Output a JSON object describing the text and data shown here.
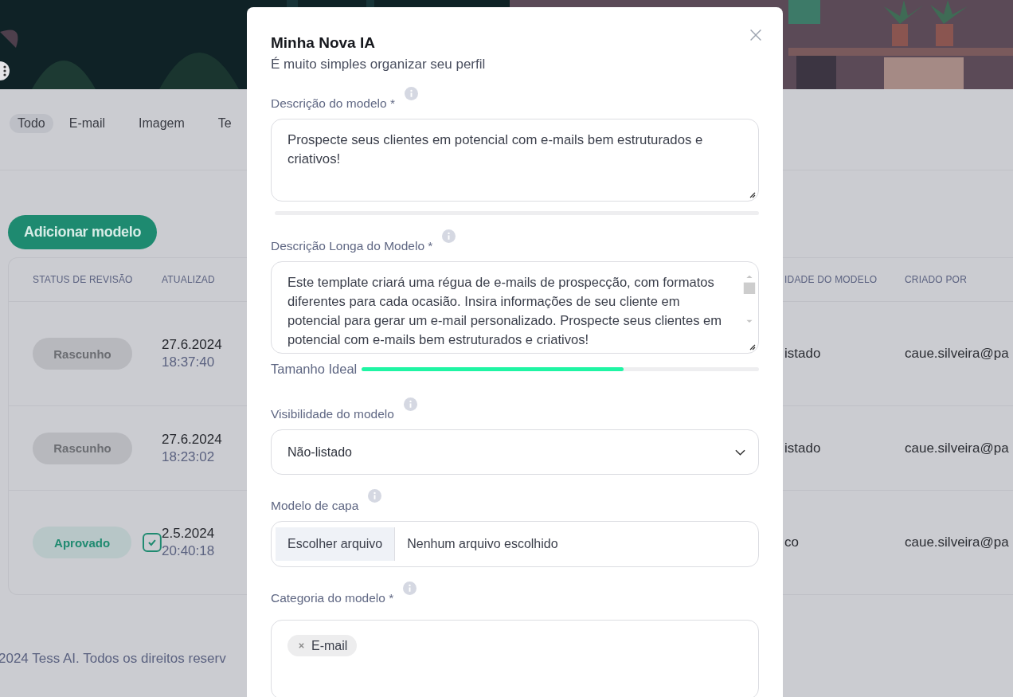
{
  "filter_tabs": [
    {
      "label": "Todo",
      "selected": true
    },
    {
      "label": "E-mail",
      "selected": false
    },
    {
      "label": "Imagem",
      "selected": false
    },
    {
      "label": "Te",
      "selected": false
    }
  ],
  "add_button": "Adicionar modelo",
  "table": {
    "columns": [
      "STATUS DE REVISÃO",
      "ATUALIZAD",
      "IDADE DO MODELO",
      "CRIADO POR"
    ],
    "rows": [
      {
        "status": "Rascunho",
        "kind": "draft",
        "verified": false,
        "date": "27.6.2024",
        "time": "18:37:40",
        "visibility": "istado",
        "author": "caue.silveira@pa"
      },
      {
        "status": "Rascunho",
        "kind": "draft",
        "verified": false,
        "date": "27.6.2024",
        "time": "18:23:02",
        "visibility": "istado",
        "author": "caue.silveira@pa"
      },
      {
        "status": "Aprovado",
        "kind": "approved",
        "verified": true,
        "date": "2.5.2024",
        "time": "20:40:18",
        "visibility": "co",
        "author": "caue.silveira@pa"
      }
    ]
  },
  "footer": "2024 Tess AI. Todos os direitos reserv",
  "modal": {
    "title": "Minha Nova IA",
    "subtitle": "É muito simples organizar seu perfil",
    "description": {
      "label": "Descrição do modelo *",
      "value": "Prospecte seus clientes em potencial com  e-mails bem estruturados e criativos!",
      "level": 0
    },
    "long_description": {
      "label": "Descrição Longa do Modelo *",
      "value": "Este template criará uma régua de e-mails de prospecção, com formatos diferentes para cada ocasião. Insira informações de seu cliente em potencial para gerar um e-mail personalizado. Prospecte seus clientes em potencial com  e-mails bem estruturados e criativos!",
      "meter_label": "Tamanho Ideal",
      "level": 0.66
    },
    "visibility": {
      "label": "Visibilidade do modelo",
      "value": "Não-listado"
    },
    "cover": {
      "label": "Modelo de capa",
      "button": "Escolher arquivo",
      "status": "Nenhum arquivo escolhido"
    },
    "category": {
      "label": "Categoria do modelo *",
      "tags": [
        "E-mail"
      ]
    }
  }
}
